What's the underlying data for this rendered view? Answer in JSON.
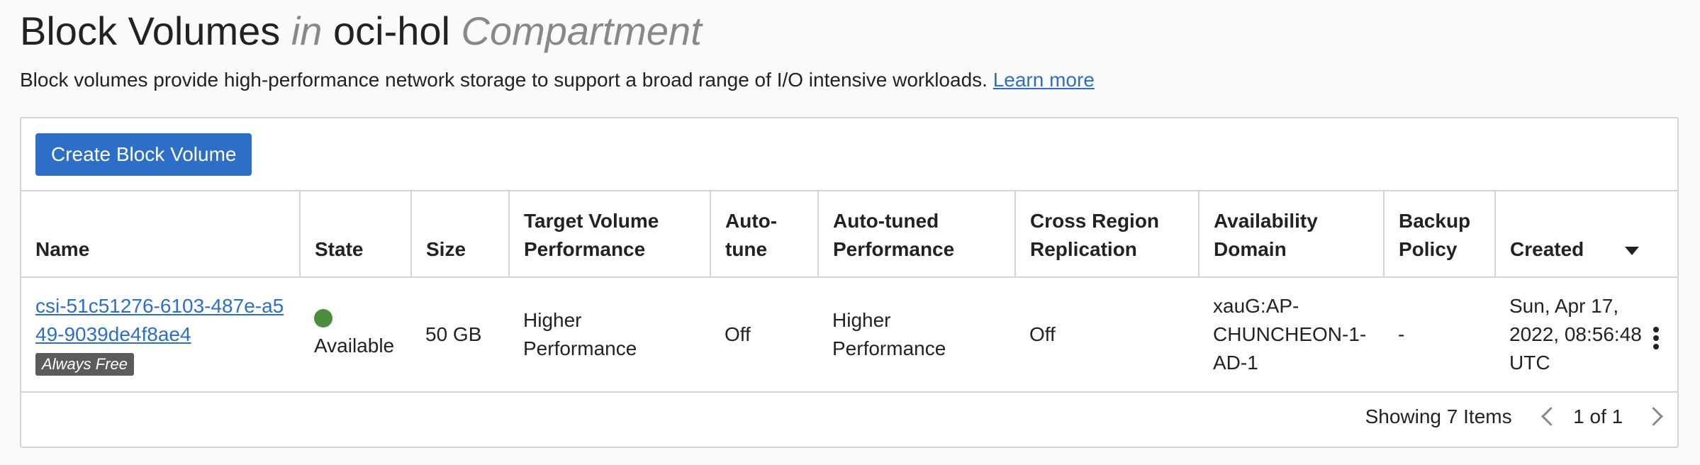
{
  "header": {
    "title_main": "Block Volumes",
    "title_in": "in",
    "title_compartment_name": "oci-hol",
    "title_compartment_word": "Compartment",
    "description": "Block volumes provide high-performance network storage to support a broad range of I/O intensive workloads.",
    "learn_more": "Learn more"
  },
  "toolbar": {
    "create_button": "Create Block Volume"
  },
  "table": {
    "columns": {
      "name": "Name",
      "state": "State",
      "size": "Size",
      "target_perf_1": "Target Volume",
      "target_perf_2": "Performance",
      "autotune_1": "Auto-",
      "autotune_2": "tune",
      "autotuned_perf_1": "Auto-tuned",
      "autotuned_perf_2": "Performance",
      "crr_1": "Cross Region",
      "crr_2": "Replication",
      "ad_1": "Availability",
      "ad_2": "Domain",
      "backup_1": "Backup",
      "backup_2": "Policy",
      "created": "Created"
    },
    "rows": [
      {
        "name": "csi-51c51276-6103-487e-a549-9039de4f8ae4",
        "badge": "Always Free",
        "state": "Available",
        "state_color": "#4e8d3f",
        "size": "50 GB",
        "target_perf": "Higher Performance",
        "autotune": "Off",
        "autotuned_perf": "Higher Performance",
        "crr": "Off",
        "ad": "xauG:AP-CHUNCHEON-1-AD-1",
        "backup": "-",
        "created": "Sun, Apr 17, 2022, 08:56:48 UTC"
      }
    ]
  },
  "footer": {
    "showing": "Showing 7 Items",
    "page": "1 of 1"
  },
  "colors": {
    "accent": "#2d6fc6",
    "status_available": "#4e8d3f"
  }
}
